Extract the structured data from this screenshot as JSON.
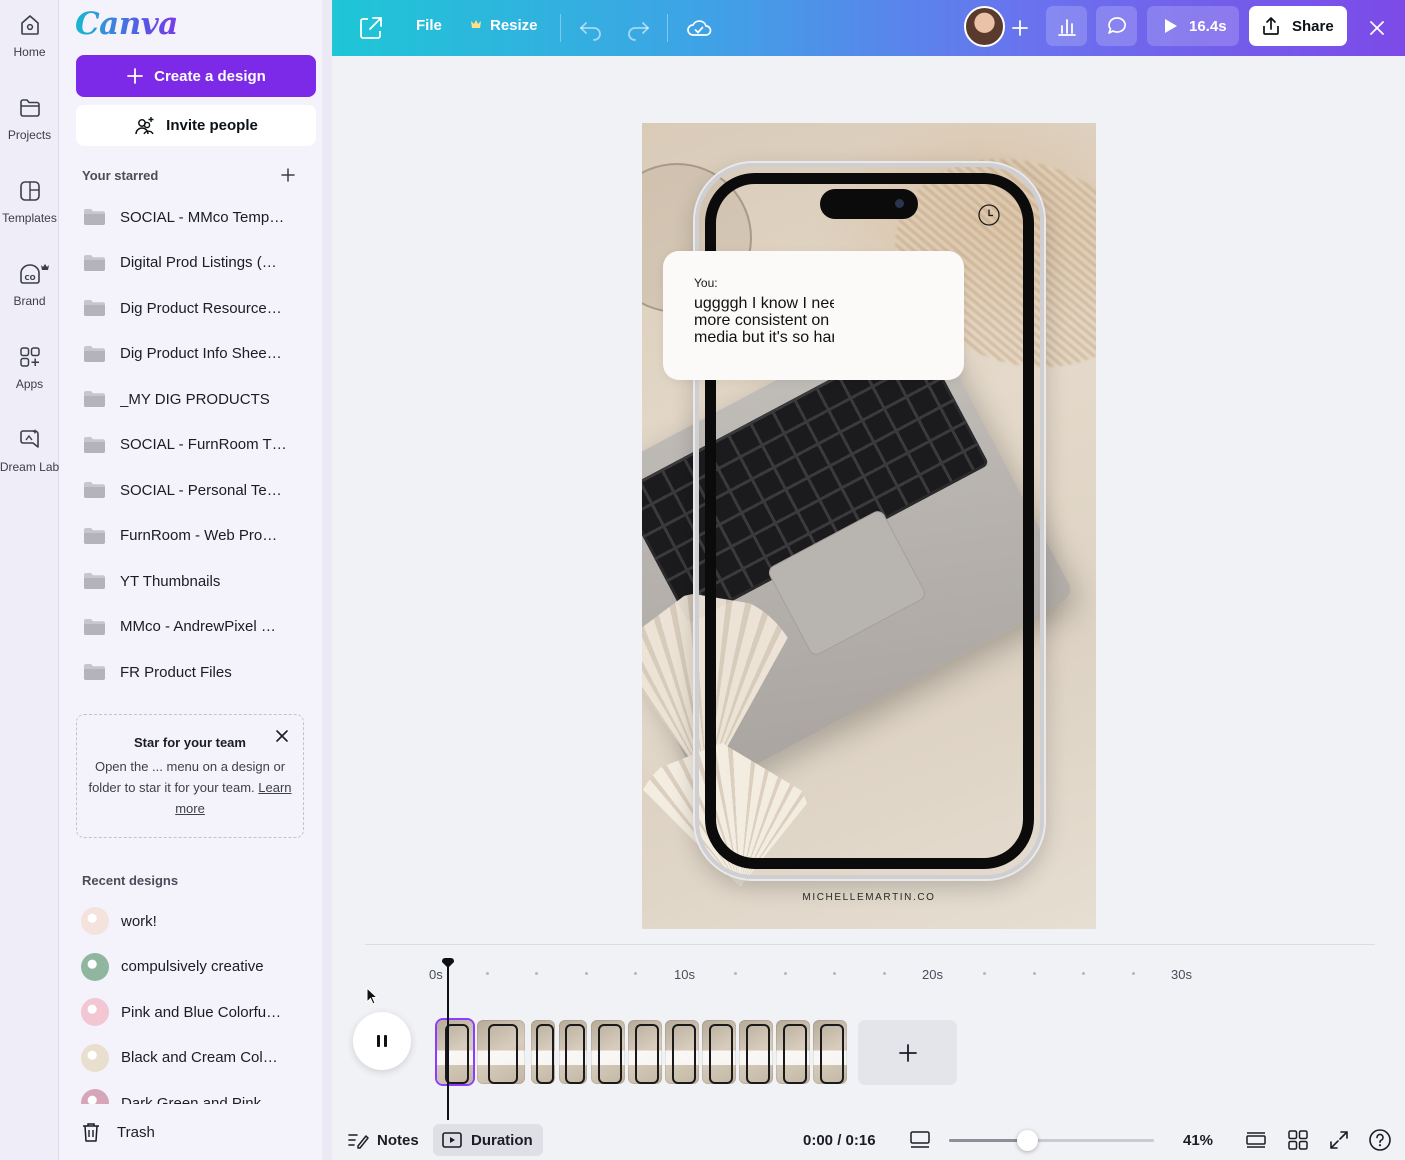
{
  "rail": {
    "items": [
      {
        "label": "Home",
        "icon": "home-icon"
      },
      {
        "label": "Projects",
        "icon": "folder-icon"
      },
      {
        "label": "Templates",
        "icon": "templates-icon"
      },
      {
        "label": "Brand",
        "icon": "brand-icon"
      },
      {
        "label": "Apps",
        "icon": "apps-icon"
      },
      {
        "label": "Dream Lab",
        "icon": "dream-lab-icon"
      }
    ]
  },
  "panel": {
    "logo": "Canva",
    "create_label": "Create a design",
    "invite_label": "Invite people",
    "starred_title": "Your starred",
    "starred": [
      "SOCIAL - MMco Temp…",
      "Digital Prod Listings (…",
      "Dig Product Resource…",
      "Dig Product Info Shee…",
      "_MY DIG PRODUCTS",
      "SOCIAL - FurnRoom T…",
      "SOCIAL - Personal Te…",
      "FurnRoom - Web Pro…",
      "YT Thumbnails",
      "MMco - AndrewPixel …",
      "FR Product Files"
    ],
    "tip": {
      "title": "Star for your team",
      "body": "Open the ... menu on a design or folder to star it for your team.",
      "link": "Learn more"
    },
    "recent_title": "Recent designs",
    "recent": [
      {
        "name": "work!",
        "color": "#f3e3dc"
      },
      {
        "name": "compulsively creative",
        "color": "#8fb7a0"
      },
      {
        "name": "Pink and Blue Colorfu…",
        "color": "#f2c6d2"
      },
      {
        "name": "Black and Cream Col…",
        "color": "#e9dfcf"
      },
      {
        "name": "Dark Green and Pink",
        "color": "#d4a6b8"
      }
    ],
    "trash_label": "Trash"
  },
  "topbar": {
    "file_label": "File",
    "resize_label": "Resize",
    "play_duration": "16.4s",
    "share_label": "Share"
  },
  "design": {
    "message_sender": "You:",
    "message_text": "uggggh I know I need to be\nmore consistent on social\nmedia but it's so hard",
    "brand": "MICHELLEMARTIN.CO"
  },
  "timeline": {
    "ticks": [
      "0s",
      "10s",
      "20s",
      "30s"
    ],
    "clip_count": 11
  },
  "bottombar": {
    "notes_label": "Notes",
    "duration_label": "Duration",
    "time": "0:00 / 0:16",
    "zoom_label": "41%",
    "zoom_fraction": 0.38
  },
  "colors": {
    "accent": "#7d2ae8",
    "selected_clip": "#8b3dff"
  }
}
